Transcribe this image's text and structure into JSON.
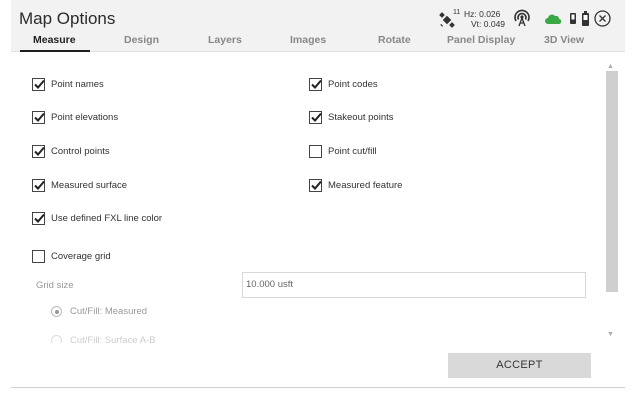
{
  "title": "Map Options",
  "tabs": [
    {
      "label": "Measure",
      "active": true
    },
    {
      "label": "Design"
    },
    {
      "label": "Layers"
    },
    {
      "label": "Images"
    },
    {
      "label": "Rotate"
    },
    {
      "label": "Panel Display"
    },
    {
      "label": "3D View"
    }
  ],
  "status": {
    "satellites": "11",
    "hz": "Hz: 0.026",
    "vt": "Vt: 0.049",
    "icons": [
      "satellite-icon",
      "radio-icon",
      "cloud-icon",
      "device-icon",
      "battery-icon",
      "close-icon"
    ],
    "cloud_color": "#3aa845"
  },
  "options": {
    "point_names": {
      "label": "Point names",
      "checked": true
    },
    "point_codes": {
      "label": "Point codes",
      "checked": true
    },
    "point_elevations": {
      "label": "Point elevations",
      "checked": true
    },
    "stakeout_points": {
      "label": "Stakeout points",
      "checked": true
    },
    "control_points": {
      "label": "Control points",
      "checked": true
    },
    "point_cut_fill": {
      "label": "Point cut/fill",
      "checked": false
    },
    "measured_surface": {
      "label": "Measured surface",
      "checked": true
    },
    "measured_feature": {
      "label": "Measured feature",
      "checked": true
    },
    "fxl_line_color": {
      "label": "Use defined FXL line color",
      "checked": true
    },
    "coverage_grid": {
      "label": "Coverage grid",
      "checked": false
    }
  },
  "grid_size": {
    "label": "Grid size",
    "value": "10.000 usft"
  },
  "cut_fill": [
    {
      "label": "Cut/Fill: Measured",
      "selected": true
    },
    {
      "label": "Cut/Fill: Surface A-B",
      "selected": false
    }
  ],
  "accept_label": "ACCEPT"
}
